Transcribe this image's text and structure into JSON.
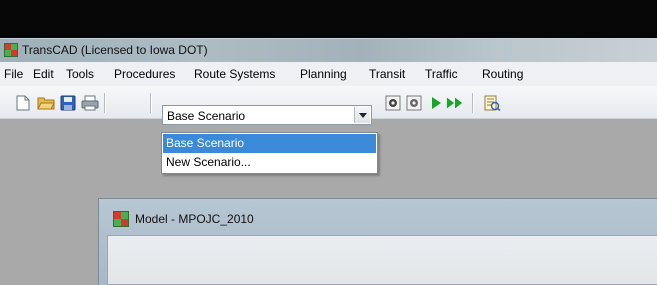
{
  "app": {
    "title": "TransCAD (Licensed to Iowa DOT)",
    "icon": "transcad-app-icon"
  },
  "menu": {
    "items": [
      "File",
      "Edit",
      "Tools",
      "Procedures",
      "Route Systems",
      "Planning",
      "Transit",
      "Traffic",
      "Routing"
    ]
  },
  "toolbar": {
    "icons": [
      "new-file-icon",
      "open-folder-icon",
      "save-icon",
      "print-icon",
      "gear-settings-icon",
      "settings-icon",
      "play-icon",
      "fast-forward-icon",
      "report-icon"
    ],
    "scenario_select": {
      "value": "Base Scenario",
      "options": [
        "Base Scenario",
        "New Scenario..."
      ],
      "highlighted_index": 0
    }
  },
  "child_window": {
    "title": "Model - MPOJC_2010",
    "icon": "model-window-icon"
  },
  "colors": {
    "highlight": "#3b89d9",
    "workspace": "#a9a9a9",
    "menubar": "#eef0f4"
  }
}
